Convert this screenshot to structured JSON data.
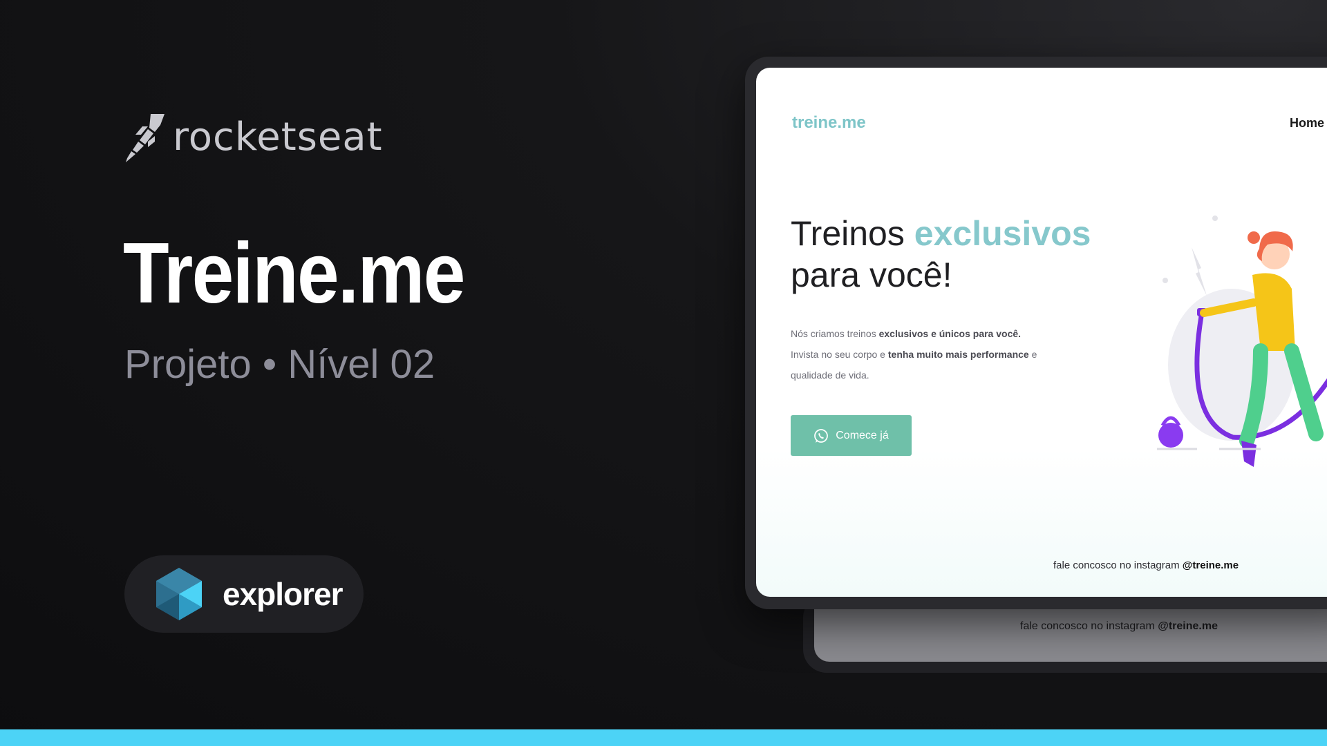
{
  "brand": {
    "icon": "rocket-icon",
    "name": "rocketseat"
  },
  "project": {
    "title": "Treine.me",
    "subtitle": "Projeto • Nível 02"
  },
  "badge": {
    "icon": "explorer-icon",
    "label": "explorer"
  },
  "mockup": {
    "site": {
      "logo": "treine.me",
      "nav_home": "Home",
      "hero_title_line1_plain": "Treinos ",
      "hero_title_line1_accent": "exclusivos",
      "hero_title_line2": "para você!",
      "desc_part1": "Nós criamos treinos ",
      "desc_bold1": "exclusivos e únicos para você.",
      "desc_part2": "Invista no seu corpo e ",
      "desc_bold2": "tenha muito mais performance",
      "desc_part3": " e qualidade de vida.",
      "cta_icon": "whatsapp-icon",
      "cta_label": "Comece já",
      "footer_text": "fale concosco no instagram ",
      "footer_handle": "@treine.me"
    },
    "back_site": {
      "footer_text": "fale concosco no instagram ",
      "footer_handle": "@treine.me"
    }
  },
  "colors": {
    "accent_bar": "#4cd3f6",
    "site_accent": "#86c8cc",
    "cta": "#6fc0a9",
    "illustration_purple": "#7b2fe0",
    "illustration_yellow": "#f5c518",
    "illustration_green": "#4fcf8d",
    "illustration_hair": "#f06a4a"
  }
}
